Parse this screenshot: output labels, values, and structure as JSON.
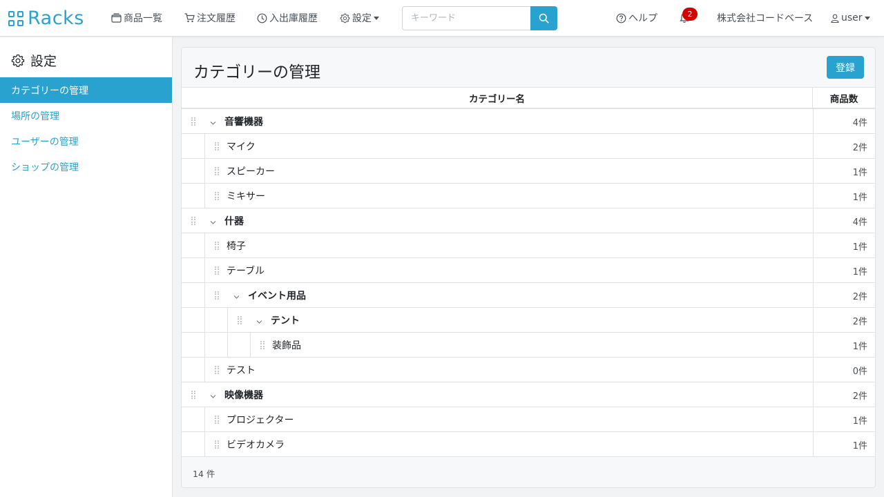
{
  "brand": {
    "name": "Racks"
  },
  "nav": {
    "items": [
      {
        "label": "商品一覧",
        "icon": "box-icon"
      },
      {
        "label": "注文履歴",
        "icon": "cart-icon"
      },
      {
        "label": "入出庫履歴",
        "icon": "clock-icon"
      },
      {
        "label": "設定",
        "icon": "gear-icon"
      }
    ],
    "help_label": "ヘルプ",
    "notification_count": "2",
    "company_label": "株式会社コードベース",
    "user_label": "user"
  },
  "search": {
    "placeholder": "キーワード",
    "value": ""
  },
  "sidebar": {
    "title": "設定",
    "items": [
      {
        "label": "カテゴリーの管理",
        "active": true
      },
      {
        "label": "場所の管理",
        "active": false
      },
      {
        "label": "ユーザーの管理",
        "active": false
      },
      {
        "label": "ショップの管理",
        "active": false
      }
    ]
  },
  "main": {
    "title": "カテゴリーの管理",
    "add_button_label": "登録",
    "columns": {
      "name": "カテゴリー名",
      "count": "商品数"
    },
    "rows": [
      {
        "name": "音響機器",
        "count": "4件",
        "level": 0,
        "expandable": true
      },
      {
        "name": "マイク",
        "count": "2件",
        "level": 1,
        "expandable": false
      },
      {
        "name": "スピーカー",
        "count": "1件",
        "level": 1,
        "expandable": false
      },
      {
        "name": "ミキサー",
        "count": "1件",
        "level": 1,
        "expandable": false
      },
      {
        "name": "什器",
        "count": "4件",
        "level": 0,
        "expandable": true
      },
      {
        "name": "椅子",
        "count": "1件",
        "level": 1,
        "expandable": false
      },
      {
        "name": "テーブル",
        "count": "1件",
        "level": 1,
        "expandable": false
      },
      {
        "name": "イベント用品",
        "count": "2件",
        "level": 1,
        "expandable": true
      },
      {
        "name": "テント",
        "count": "2件",
        "level": 2,
        "expandable": true
      },
      {
        "name": "装飾品",
        "count": "1件",
        "level": 3,
        "expandable": false
      },
      {
        "name": "テスト",
        "count": "0件",
        "level": 1,
        "expandable": false
      },
      {
        "name": "映像機器",
        "count": "2件",
        "level": 0,
        "expandable": true
      },
      {
        "name": "プロジェクター",
        "count": "1件",
        "level": 1,
        "expandable": false
      },
      {
        "name": "ビデオカメラ",
        "count": "1件",
        "level": 1,
        "expandable": false
      }
    ],
    "footer_count": "14 件"
  },
  "colors": {
    "accent": "#2aa2cf",
    "badge": "#d40000",
    "border": "#dee2e6"
  }
}
